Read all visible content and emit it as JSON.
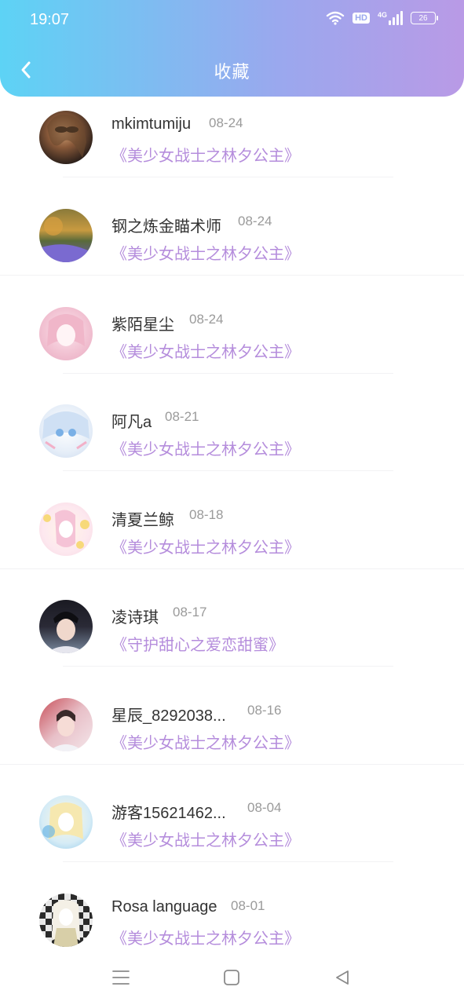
{
  "status_bar": {
    "time": "19:07",
    "hd": "HD",
    "network": "4G",
    "battery": "26"
  },
  "header": {
    "title": "收藏",
    "back_icon": "chevron-left-icon"
  },
  "favorites": [
    {
      "username": "mkimtumiju",
      "date": "08-24",
      "work": "《美少女战士之林夕公主》"
    },
    {
      "username": "钢之炼金瞄术师",
      "date": "08-24",
      "work": "《美少女战士之林夕公主》"
    },
    {
      "username": "紫陌星尘",
      "date": "08-24",
      "work": "《美少女战士之林夕公主》"
    },
    {
      "username": "阿凡a",
      "date": "08-21",
      "work": "《美少女战士之林夕公主》"
    },
    {
      "username": "清夏兰鲸",
      "date": "08-18",
      "work": "《美少女战士之林夕公主》"
    },
    {
      "username": "凌诗琪",
      "date": "08-17",
      "work": "《守护甜心之爱恋甜蜜》"
    },
    {
      "username": "星辰_8292038...",
      "date": "08-16",
      "work": "《美少女战士之林夕公主》"
    },
    {
      "username": "游客15621462...",
      "date": "08-04",
      "work": "《美少女战士之林夕公主》"
    },
    {
      "username": "Rosa language",
      "date": "08-01",
      "work": "《美少女战士之林夕公主》"
    }
  ],
  "nav": {
    "menu_icon": "menu-icon",
    "home_icon": "home-square-icon",
    "back_icon": "back-triangle-icon"
  },
  "colors": {
    "header_start": "#5dd3f5",
    "header_end": "#b99ae6",
    "work_title": "#b58ddc",
    "date": "#9a9a9a"
  }
}
